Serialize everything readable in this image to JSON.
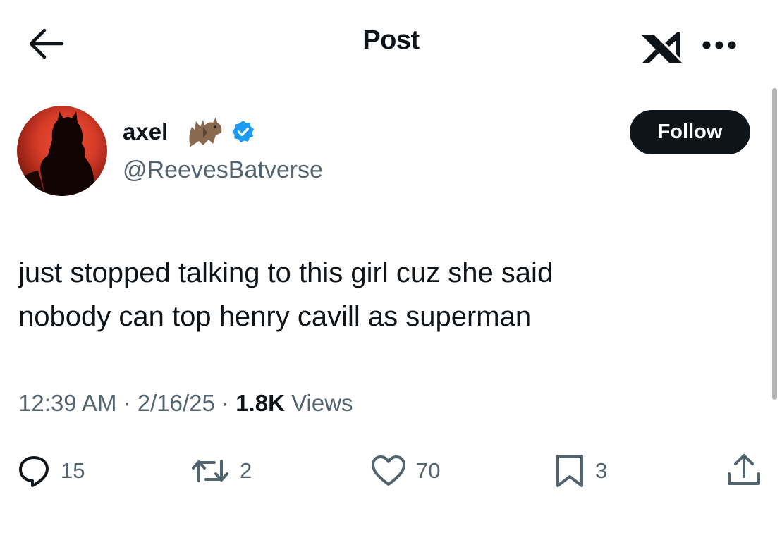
{
  "header": {
    "title": "Post",
    "back_icon": "arrow-left-icon",
    "brand_icon": "grok-logo-icon",
    "more_icon": "more-dots-icon"
  },
  "author": {
    "display_name": "axel",
    "name_emoji": "bat-emoji",
    "handle": "@ReevesBatverse",
    "verified": true,
    "verified_color": "#1d9bf0",
    "follow_label": "Follow"
  },
  "tweet": {
    "text_line1": "just stopped talking to this girl cuz she said",
    "text_line2": "nobody can top henry cavill as superman"
  },
  "meta": {
    "time": "12:39 AM",
    "sep1": " · ",
    "date": "2/16/25",
    "sep2": " · ",
    "views_count": "1.8K",
    "views_label": " Views"
  },
  "actions": {
    "replies": "15",
    "reposts": "2",
    "likes": "70",
    "bookmarks": "3"
  },
  "colors": {
    "text": "#0f1419",
    "secondary": "#536471",
    "follow_bg": "#0f1419",
    "verified": "#1d9bf0"
  }
}
